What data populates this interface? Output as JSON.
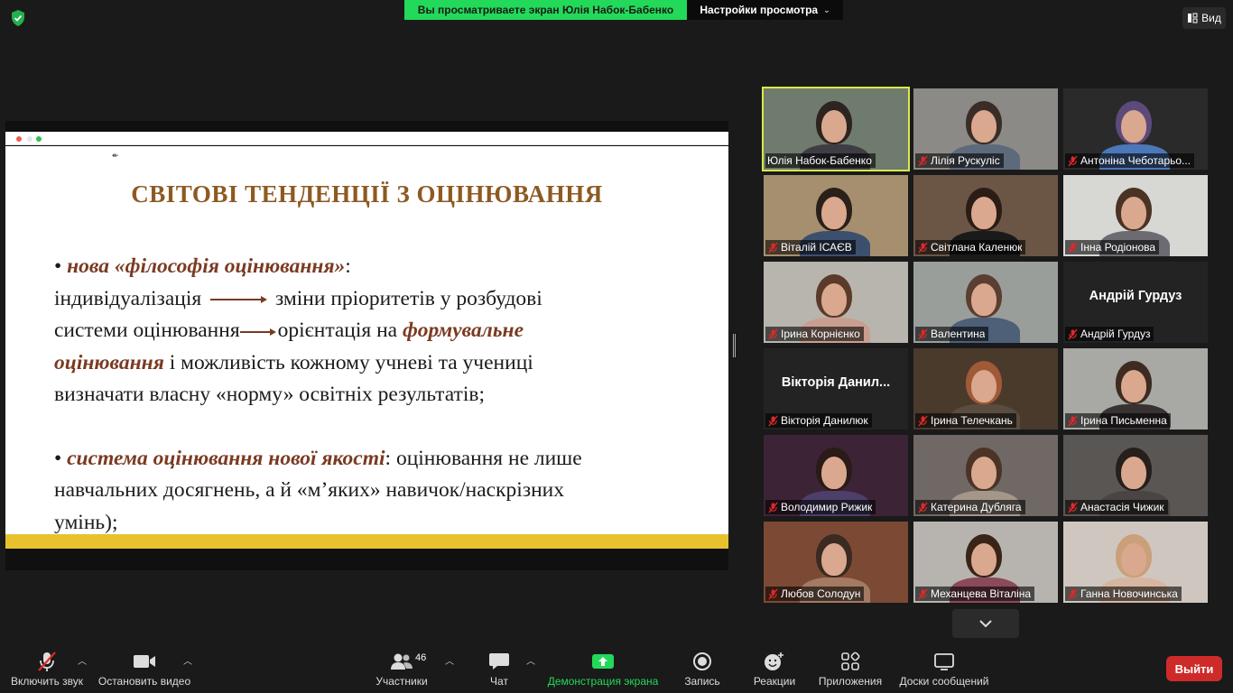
{
  "top": {
    "banner": "Вы просматриваете экран Юлія Набок-Бабенко",
    "view_settings": "Настройки просмотра",
    "view_button": "Вид"
  },
  "slide": {
    "title": "СВІТОВІ ТЕНДЕНЦІЇ З ОЦІНЮВАННЯ",
    "p1_bullet": "•",
    "p1_em": "нова «філософія оцінювання»",
    "p1_colon": ":",
    "p1_line2a": "індивідуалізація",
    "p1_line2b": "зміни пріоритетів у розбудові",
    "p1_line3a": "системи оцінювання",
    "p1_line3b": "орієнтація на",
    "p1_em2a": "формувальне",
    "p1_em2b": "оцінювання",
    "p1_line4": "і можливість кожному учневі та учениці",
    "p1_line5": "визначати власну «норму» освітніх результатів;",
    "p2_em": "система оцінювання нової якості",
    "p2_line1": ": оцінювання не лише",
    "p2_line2": "навчальних досягнень, а й «м’яких» навичок/наскрізних",
    "p2_line3": "умінь);"
  },
  "participants": [
    {
      "name": "Юлія Набок-Бабенко",
      "muted": false
    },
    {
      "name": "Лілія Рускуліс",
      "muted": true
    },
    {
      "name": "Антоніна Чеботарьо...",
      "muted": true
    },
    {
      "name": "Віталій ІСАЄВ",
      "muted": true
    },
    {
      "name": "Світлана Каленюк",
      "muted": true
    },
    {
      "name": "Інна Родіонова",
      "muted": true
    },
    {
      "name": "Ірина Корнієнко",
      "muted": true
    },
    {
      "name": "Валентина",
      "muted": true
    },
    {
      "name": "Андрій Гурдуз",
      "muted": true,
      "video_off_name": "Андрій Гурдуз"
    },
    {
      "name": "Вікторія Данилюк",
      "muted": true,
      "video_off_name": "Вікторія Данил..."
    },
    {
      "name": "Ірина Телечкань",
      "muted": true
    },
    {
      "name": "Ірина Письменна",
      "muted": true
    },
    {
      "name": "Володимир Рижик",
      "muted": true
    },
    {
      "name": "Катерина Дубляга",
      "muted": true
    },
    {
      "name": "Анастасія Чижик",
      "muted": true
    },
    {
      "name": "Любов Солодун",
      "muted": true
    },
    {
      "name": "Механцева Віталіна",
      "muted": true
    },
    {
      "name": "Ганна Новочинська",
      "muted": true
    }
  ],
  "toolbar": {
    "unmute": "Включить звук",
    "stop_video": "Остановить видео",
    "participants": "Участники",
    "participants_count": "46",
    "chat": "Чат",
    "share_screen": "Демонстрация экрана",
    "record": "Запись",
    "reactions": "Реакции",
    "apps": "Приложения",
    "whiteboards": "Доски сообщений",
    "leave": "Выйти"
  },
  "colors": {
    "share_green": "#23d959",
    "slide_title": "#8d5a22",
    "slide_emphasis": "#7a3a22",
    "slide_strip": "#e8c22d",
    "active_speaker": "#d9e84c",
    "mute_red": "#e02828",
    "leave_red": "#cf2a2a"
  }
}
